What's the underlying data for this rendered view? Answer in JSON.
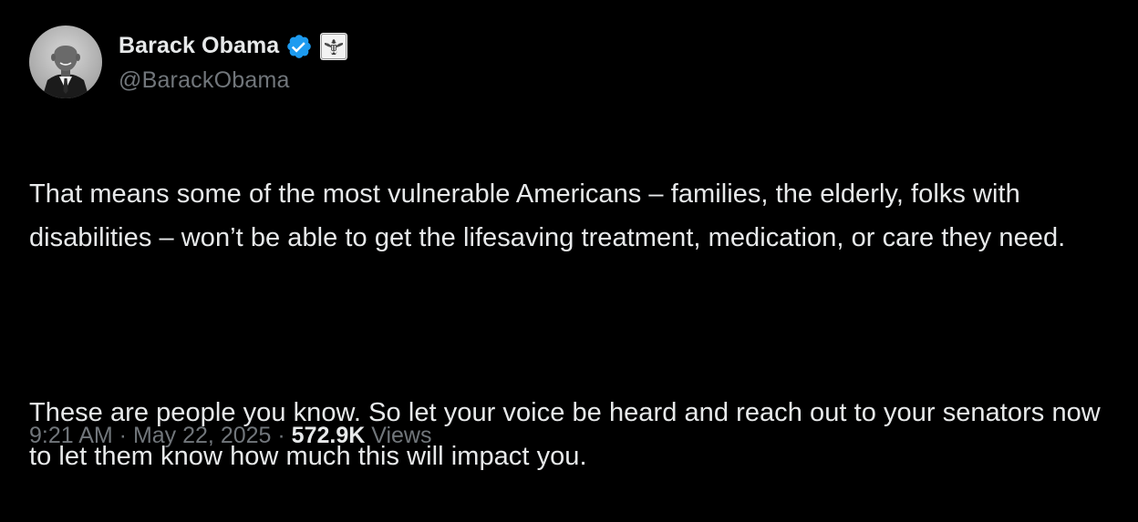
{
  "author": {
    "display_name": "Barack Obama",
    "handle": "@BarackObama",
    "verified_badge_color": "#1d9bf0",
    "affiliation_badge": "us-government-seal-icon",
    "avatar": "profile-photo"
  },
  "post": {
    "paragraphs": [
      "That means some of the most vulnerable Americans – families, the elderly, folks with disabilities – won’t be able to get the lifesaving treatment, medication, or care they need.",
      "These are people you know. So let your voice be heard and reach out to your senators now to let them know how much this will impact you."
    ]
  },
  "meta": {
    "time": "9:21 AM",
    "separator": " · ",
    "date": "May 22, 2025",
    "views_count": "572.9K",
    "views_label": " Views"
  },
  "colors": {
    "background": "#000000",
    "primary_text": "#e7e9ea",
    "secondary_text": "#71767b"
  }
}
